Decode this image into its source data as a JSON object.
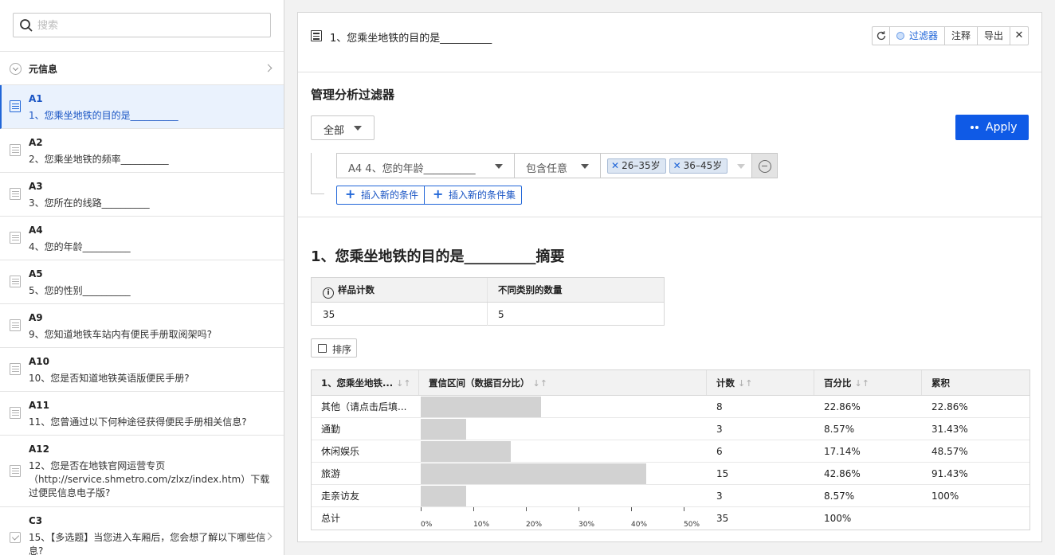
{
  "search": {
    "placeholder": "搜索"
  },
  "meta": {
    "label": "元信息"
  },
  "questions": [
    {
      "code": "A1",
      "text": "1、您乘坐地铁的目的是__________"
    },
    {
      "code": "A2",
      "text": "2、您乘坐地铁的频率__________"
    },
    {
      "code": "A3",
      "text": "3、您所在的线路__________"
    },
    {
      "code": "A4",
      "text": "4、您的年龄__________"
    },
    {
      "code": "A5",
      "text": "5、您的性别__________"
    },
    {
      "code": "A9",
      "text": "9、您知道地铁车站内有便民手册取阅架吗?"
    },
    {
      "code": "A10",
      "text": "10、您是否知道地铁英语版便民手册?"
    },
    {
      "code": "A11",
      "text": "11、您曾通过以下何种途径获得便民手册相关信息?"
    },
    {
      "code": "A12",
      "text": "12、您是否在地铁官网运营专页（http://service.shmetro.com/zlxz/index.htm）下载过便民信息电子版?"
    },
    {
      "code": "C3",
      "text": "15、【多选题】当您进入车厢后，您会想了解以下哪些信息?"
    }
  ],
  "panel": {
    "title": "1、您乘坐地铁的目的是__________",
    "tools": {
      "filter": "过滤器",
      "notes": "注释",
      "export": "导出",
      "close": "✕"
    },
    "filter": {
      "title": "管理分析过滤器",
      "scope": "全部",
      "apply": "Apply",
      "condition": {
        "field": "A4 4、您的年龄__________",
        "operator": "包含任意",
        "tags": [
          "26–35岁",
          "36–45岁"
        ]
      },
      "insert_condition": "插入新的条件",
      "insert_condition_set": "插入新的条件集"
    },
    "summary": {
      "title": "1、您乘坐地铁的目的是__________摘要",
      "headers": [
        "样品计数",
        "不同类别的数量"
      ],
      "values": [
        "35",
        "5"
      ],
      "sort_label": "排序"
    },
    "table": {
      "headers": [
        "1、您乘坐地铁...",
        "置信区间（数据百分比）",
        "计数",
        "百分比",
        "累积"
      ],
      "rows": [
        {
          "label": "其他（请点击后填...",
          "count": "8",
          "pct": "22.86%",
          "cum": "22.86%",
          "value": 22.86
        },
        {
          "label": "通勤",
          "count": "3",
          "pct": "8.57%",
          "cum": "31.43%",
          "value": 8.57
        },
        {
          "label": "休闲娱乐",
          "count": "6",
          "pct": "17.14%",
          "cum": "48.57%",
          "value": 17.14
        },
        {
          "label": "旅游",
          "count": "15",
          "pct": "42.86%",
          "cum": "91.43%",
          "value": 42.86
        },
        {
          "label": "走亲访友",
          "count": "3",
          "pct": "8.57%",
          "cum": "100%",
          "value": 8.57
        }
      ],
      "total": {
        "label": "总计",
        "count": "35",
        "pct": "100%"
      },
      "axis_ticks": [
        "0%",
        "10%",
        "20%",
        "30%",
        "40%",
        "50%"
      ]
    }
  }
}
